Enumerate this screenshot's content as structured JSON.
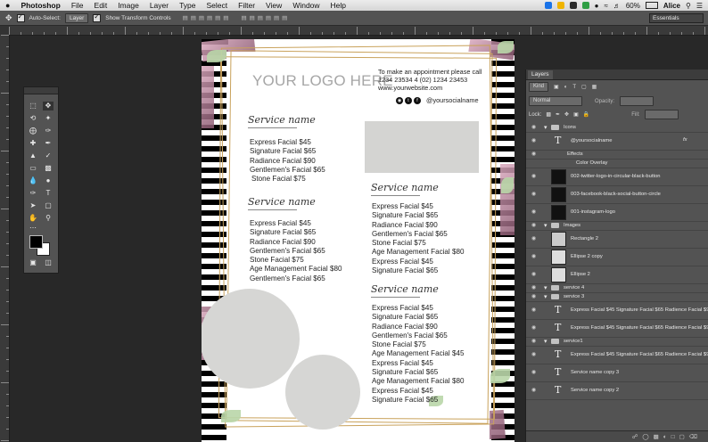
{
  "menubar": {
    "apple": "",
    "app": "Photoshop",
    "items": [
      "File",
      "Edit",
      "Image",
      "Layer",
      "Type",
      "Select",
      "Filter",
      "View",
      "Window",
      "Help"
    ],
    "battery": "60%",
    "user": "Alice"
  },
  "options": {
    "auto_select_label": "Auto-Select:",
    "auto_select_value": "Layer",
    "transform_label": "Show Transform Controls",
    "workspace": "Essentials"
  },
  "document": {
    "logo": "YOUR LOGO HERE",
    "contact": [
      "To make an appointment please call",
      "1234 23534 4 (02) 1234 23453",
      "www.yourwebsite.com"
    ],
    "social": "@yoursocialname",
    "service_title": "Service name",
    "section1": [
      "Express Facial $45",
      "Signature Facial $65",
      "Radiance Facial $90",
      "Gentlemen's Facial $65",
      "Stone Facial $75"
    ],
    "section2": [
      "Express Facial $45",
      "Signature Facial $65",
      "Radiance Facial $90",
      "Gentlemen's Facial $65",
      "Stone Facial $75",
      "Age Management Facial $80",
      "Gentlemen's Facial $65"
    ],
    "section3": [
      "Express Facial $45",
      "Signature Facial $65",
      "Radiance Facial $90",
      "Gentlemen's Facial $65",
      "Stone Facial $75",
      "Age Management Facial $80",
      "Express Facial $45",
      "Signature Facial $65"
    ],
    "section4": [
      "Express Facial $45",
      "Signature Facial $65",
      "Radiance Facial $90",
      "Gentlemen's Facial $65",
      "Stone Facial $75",
      "Age Management Facial $45",
      "Express Facial $45",
      "Signature Facial $65",
      "Age Management Facial $80",
      "Express Facial $45",
      "Signature Facial $65"
    ]
  },
  "layers_panel": {
    "tab": "Layers",
    "kind": "Kind",
    "blend": "Normal",
    "opacity_label": "Opacity:",
    "lock_label": "Lock:",
    "fill_label": "Fill:",
    "rows": [
      {
        "name": "Icons",
        "kind": "group"
      },
      {
        "name": "@yoursocialname",
        "kind": "text"
      },
      {
        "name": "Effects",
        "kind": "fx"
      },
      {
        "name": "Color Overlay",
        "kind": "fx"
      },
      {
        "name": "002-twitter-logo-in-circular-black-button",
        "kind": "image"
      },
      {
        "name": "003-facebook-black-social-button-circle",
        "kind": "image"
      },
      {
        "name": "001-instagram-logo",
        "kind": "image"
      },
      {
        "name": "Images",
        "kind": "group"
      },
      {
        "name": "Rectangle 2",
        "kind": "image"
      },
      {
        "name": "Ellipse 2 copy",
        "kind": "image"
      },
      {
        "name": "Ellipse 2",
        "kind": "image"
      },
      {
        "name": "service 4",
        "kind": "group"
      },
      {
        "name": "service 3",
        "kind": "group"
      },
      {
        "name": "Express Facial $45  Signature Facial $65 Radience Facial $90  G",
        "kind": "text"
      },
      {
        "name": "Express Facial $45  Signature Facial $65 Radience Facial $90  G",
        "kind": "text"
      },
      {
        "name": "service1",
        "kind": "group"
      },
      {
        "name": "Express Facial $45  Signature Facial $65 Radience Facial $90  G",
        "kind": "text"
      },
      {
        "name": "Service name  copy 3",
        "kind": "text"
      },
      {
        "name": "Service name  copy 2",
        "kind": "text"
      }
    ]
  },
  "colors": {
    "gold": "#c9a25b",
    "pink": "#c98aa6",
    "placeholder": "#d4d4d2"
  }
}
